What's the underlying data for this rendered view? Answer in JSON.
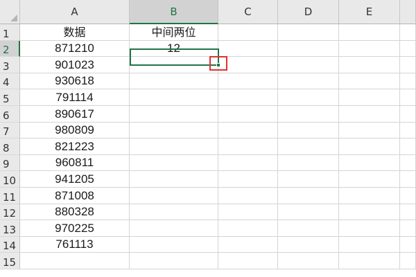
{
  "columns": [
    "A",
    "B",
    "C",
    "D",
    "E"
  ],
  "selected_column": "B",
  "selected_row": "2",
  "rows": [
    {
      "num": "1",
      "a": "数据",
      "b": "中间两位"
    },
    {
      "num": "2",
      "a": "871210",
      "b": "12"
    },
    {
      "num": "3",
      "a": "901023",
      "b": ""
    },
    {
      "num": "4",
      "a": "930618",
      "b": ""
    },
    {
      "num": "5",
      "a": "791114",
      "b": ""
    },
    {
      "num": "6",
      "a": "890617",
      "b": ""
    },
    {
      "num": "7",
      "a": "980809",
      "b": ""
    },
    {
      "num": "8",
      "a": "821223",
      "b": ""
    },
    {
      "num": "9",
      "a": "960811",
      "b": ""
    },
    {
      "num": "10",
      "a": "941205",
      "b": ""
    },
    {
      "num": "11",
      "a": "871008",
      "b": ""
    },
    {
      "num": "12",
      "a": "880328",
      "b": ""
    },
    {
      "num": "13",
      "a": "970225",
      "b": ""
    },
    {
      "num": "14",
      "a": "761113",
      "b": ""
    },
    {
      "num": "15",
      "a": "",
      "b": ""
    }
  ],
  "colors": {
    "selection": "#217346",
    "highlight": "#e03030",
    "header_bg": "#e9e9e9",
    "gridline": "#d4d4d4"
  }
}
